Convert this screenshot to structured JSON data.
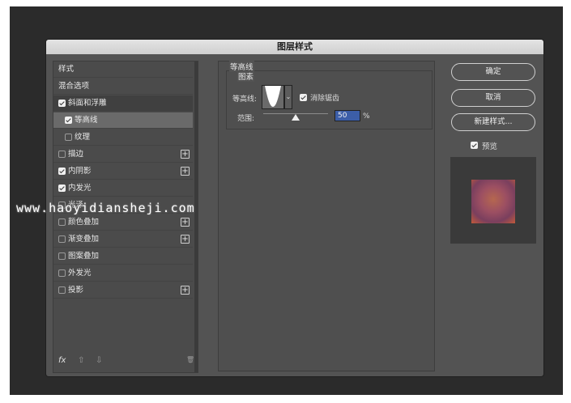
{
  "dialog": {
    "title": "图层样式"
  },
  "sidebar": {
    "items": [
      {
        "label": "样式"
      },
      {
        "label": "混合选项"
      },
      {
        "label": "斜面和浮雕",
        "checked": true
      },
      {
        "label": "等高线",
        "checked": true
      },
      {
        "label": "纹理",
        "checked": false
      },
      {
        "label": "描边",
        "checked": false
      },
      {
        "label": "内阴影",
        "checked": true
      },
      {
        "label": "内发光",
        "checked": true
      },
      {
        "label": "光泽",
        "checked": false
      },
      {
        "label": "颜色叠加",
        "checked": false
      },
      {
        "label": "渐变叠加",
        "checked": false
      },
      {
        "label": "图案叠加",
        "checked": false
      },
      {
        "label": "外发光",
        "checked": false
      },
      {
        "label": "投影",
        "checked": false
      }
    ],
    "plus_symbol": "+",
    "footer": {
      "fx": "fx",
      "up": "⇧",
      "down": "⇩",
      "trash": "🗑"
    }
  },
  "contour_panel": {
    "section_title": "等高线",
    "group_title": "图素",
    "contour_label": "等高线:",
    "dropdown_arrow": "⌄",
    "anti_alias_label": "消除锯齿",
    "anti_alias_checked": true,
    "range_label": "范围:",
    "range_value": "50",
    "range_unit": "%",
    "range_level_percent": 50
  },
  "buttons": {
    "ok": "确定",
    "cancel": "取消",
    "new_style": "新建样式..."
  },
  "preview": {
    "label": "预览",
    "checked": true
  },
  "watermark": "www.haoyidiansheji.com",
  "colors": {
    "dialog_bg": "#535353",
    "selected_row": "#6a6a6a",
    "range_field": "#3c5ea8"
  }
}
